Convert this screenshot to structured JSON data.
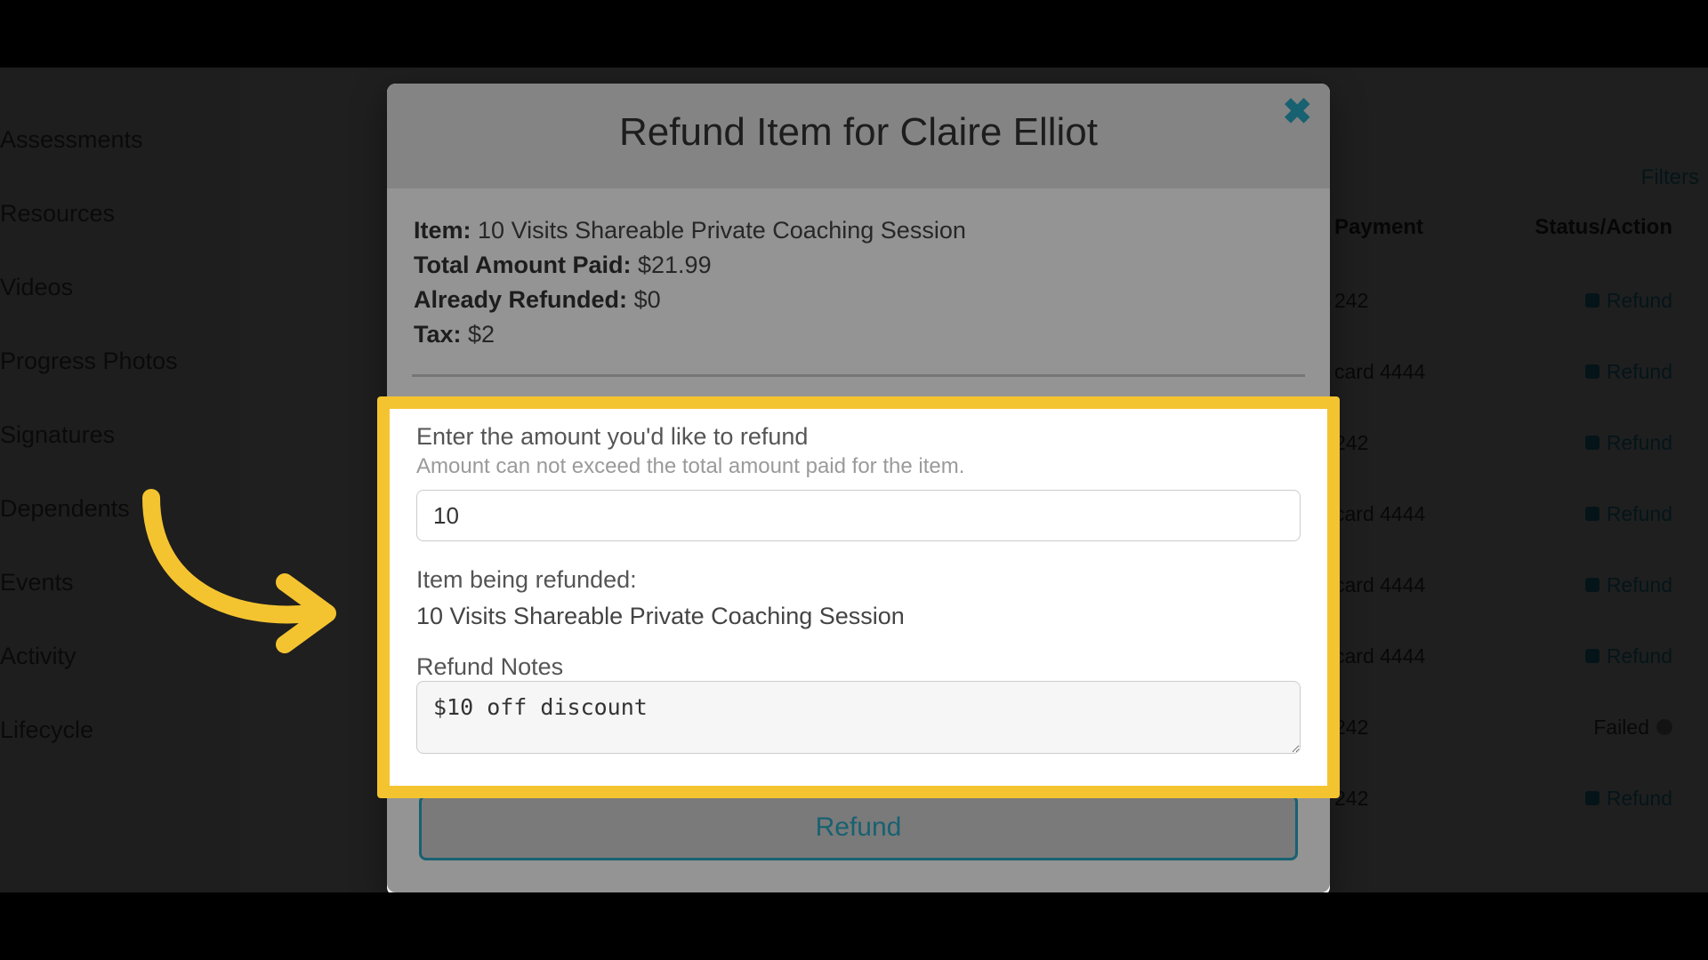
{
  "sidebar": {
    "items": [
      {
        "label": "Assessments"
      },
      {
        "label": "Resources"
      },
      {
        "label": "Videos"
      },
      {
        "label": "Progress Photos"
      },
      {
        "label": "Signatures"
      },
      {
        "label": "Dependents"
      },
      {
        "label": "Events"
      },
      {
        "label": "Activity"
      },
      {
        "label": "Lifecycle"
      }
    ]
  },
  "right_panel": {
    "filters_label": "Filters",
    "header_payment": "Payment",
    "header_status": "Status/Action",
    "rows": [
      {
        "payment_suffix": "242",
        "action": "Refund",
        "action_type": "badge"
      },
      {
        "payment_suffix": "card 4444",
        "action": "Refund",
        "action_type": "badge"
      },
      {
        "payment_suffix": "242",
        "action": "Refund",
        "action_type": "badge"
      },
      {
        "payment_suffix": "card 4444",
        "action": "Refund",
        "action_type": "badge"
      },
      {
        "payment_suffix": "card 4444",
        "action": "Refund",
        "action_type": "badge"
      },
      {
        "payment_suffix": "card 4444",
        "action": "Refund",
        "action_type": "badge"
      },
      {
        "payment_suffix": "242",
        "action": "Failed",
        "action_type": "notice"
      },
      {
        "payment_suffix": "242",
        "action": "Refund",
        "action_type": "badge"
      }
    ]
  },
  "modal": {
    "title": "Refund Item for Claire Elliot",
    "close_label": "✖",
    "summary": {
      "item_label": "Item:",
      "item_value": "10 Visits Shareable Private Coaching Session",
      "total_label": "Total Amount Paid:",
      "total_value": "$21.99",
      "refunded_label": "Already Refunded:",
      "refunded_value": "$0",
      "tax_label": "Tax:",
      "tax_value": "$2"
    },
    "form": {
      "amount_label": "Enter the amount you'd like to refund",
      "amount_hint": "Amount can not exceed the total amount paid for the item.",
      "amount_value": "10",
      "item_being_refunded_label": "Item being refunded:",
      "item_being_refunded_value": "10 Visits Shareable Private Coaching Session",
      "notes_label": "Refund Notes",
      "notes_value": "$10 off discount"
    },
    "refund_button": "Refund"
  },
  "colors": {
    "accent": "#2aa7c3",
    "highlight_border": "#f4c430"
  }
}
